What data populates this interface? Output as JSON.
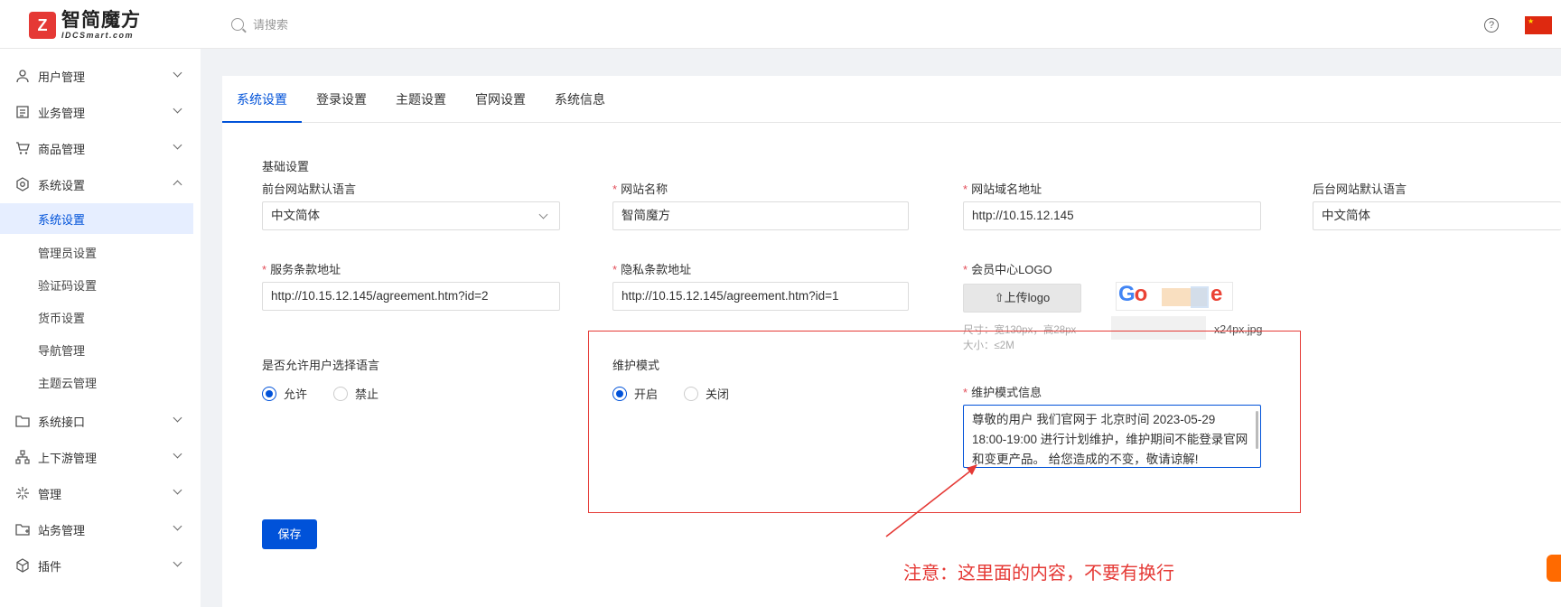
{
  "app": {
    "logo_mark": "Z",
    "logo_cn": "智简魔方",
    "logo_en": "IDCSmart.com"
  },
  "header": {
    "search_placeholder": "请搜索",
    "help_icon": "question-circle-icon",
    "flag_icon": "china-flag-icon"
  },
  "sidebar": {
    "items": [
      {
        "label": "用户管理",
        "icon": "user-icon"
      },
      {
        "label": "业务管理",
        "icon": "document-icon"
      },
      {
        "label": "商品管理",
        "icon": "cart-icon"
      },
      {
        "label": "系统设置",
        "icon": "settings-icon"
      },
      {
        "label": "系统接口",
        "icon": "folder-icon"
      },
      {
        "label": "上下游管理",
        "icon": "tree-icon"
      },
      {
        "label": "管理",
        "icon": "spark-icon"
      },
      {
        "label": "站务管理",
        "icon": "folder-plus-icon"
      },
      {
        "label": "插件",
        "icon": "cube-icon"
      }
    ],
    "sub_items": [
      "系统设置",
      "管理员设置",
      "验证码设置",
      "货币设置",
      "导航管理",
      "主题云管理"
    ]
  },
  "tabs": [
    "系统设置",
    "登录设置",
    "主题设置",
    "官网设置",
    "系统信息"
  ],
  "form": {
    "section_title": "基础设置",
    "front_lang_label": "前台网站默认语言",
    "front_lang_value": "中文简体",
    "site_name_label": "网站名称",
    "site_name_value": "智简魔方",
    "domain_label": "网站域名地址",
    "domain_value": "http://10.15.12.145",
    "admin_lang_label": "后台网站默认语言",
    "admin_lang_value": "中文简体",
    "terms_label": "服务条款地址",
    "terms_value": "http://10.15.12.145/agreement.htm?id=2",
    "privacy_label": "隐私条款地址",
    "privacy_value": "http://10.15.12.145/agreement.htm?id=1",
    "member_logo_label": "会员中心LOGO",
    "upload_label": "⇧上传logo",
    "logo_hint_size": "尺寸：宽130px，高28px",
    "logo_hint_filesize": "大小：≤2M",
    "logo_filename": "x24px.jpg",
    "lang_select_label": "是否允许用户选择语言",
    "lang_allow": "允许",
    "lang_deny": "禁止",
    "maint_label": "维护模式",
    "maint_on": "开启",
    "maint_off": "关闭",
    "maint_msg_label": "维护模式信息",
    "maint_msg_value": "尊敬的用户 我们官网于 北京时间 2023-05-29 18:00-19:00 进行计划维护，维护期间不能登录官网和变更产品。 给您造成的不变，敬请谅解!",
    "save_label": "保存"
  },
  "annotation": {
    "note": "注意：这里面的内容，不要有换行",
    "color": "#e53935"
  },
  "colors": {
    "primary": "#0052d9",
    "required": "#e34d59"
  }
}
